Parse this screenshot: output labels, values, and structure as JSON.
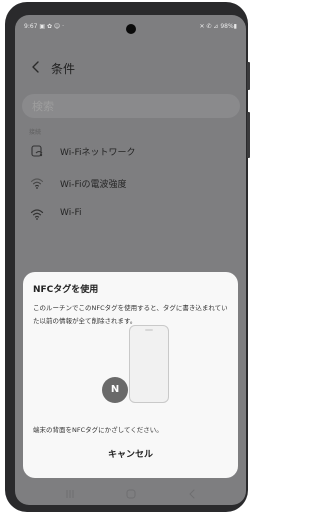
{
  "status_bar": {
    "time": "9:67",
    "left_icons": "▣ ✿ ☺ ·",
    "right_text": "✕ ✆ ⊿ 98%▮"
  },
  "header": {
    "back_icon": "chevron-left-icon",
    "title": "条件"
  },
  "search": {
    "placeholder": "検索"
  },
  "section": {
    "label": "接続"
  },
  "rows": [
    {
      "icon": "wifi-settings-icon",
      "label": "Wi-Fiネットワーク"
    },
    {
      "icon": "wifi-signal-icon",
      "label": "Wi-Fiの電波強度"
    },
    {
      "icon": "wifi-icon",
      "label": "Wi-Fi"
    }
  ],
  "dialog": {
    "title": "NFCタグを使用",
    "description": "このルーチンでこのNFCタグを使用すると、タグに書き込まれていた以前の情報が全て削除されます。",
    "nfc_symbol": "N",
    "instruction": "端末の背面をNFCタグにかざしてください。",
    "cancel": "キャンセル"
  },
  "nav_bar": {
    "recent": "recent-apps-icon",
    "home": "home-icon",
    "back": "back-icon"
  },
  "colors": {
    "dim_overlay": "#7e7e80",
    "dialog_bg": "#f8f8f8",
    "phone_frame": "#2a2a2c",
    "nfc_badge": "#6a6a6a"
  }
}
